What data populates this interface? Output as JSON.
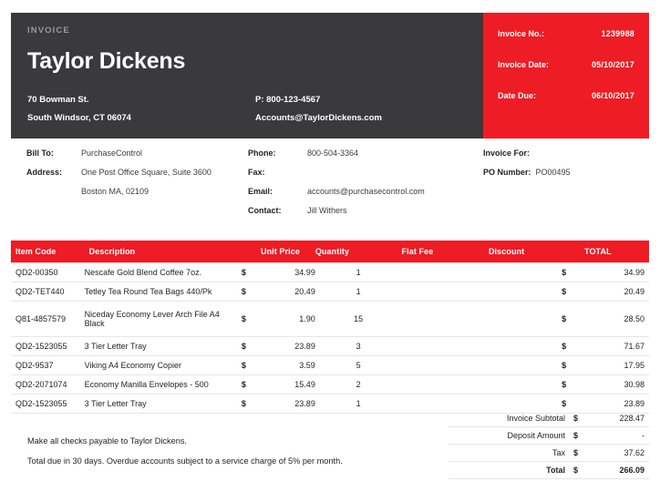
{
  "header": {
    "kicker": "INVOICE",
    "company_name": "Taylor Dickens",
    "address_line1": "70 Bowman St.",
    "address_line2": "South Windsor, CT 06074",
    "phone": "P: 800-123-4567",
    "email": "Accounts@TaylorDickens.com",
    "panel_dark_color": "#3a3a3c",
    "panel_red_color": "#ee1c25"
  },
  "invoice_meta": [
    {
      "label": "Invoice No.:",
      "value": "1239988"
    },
    {
      "label": "Invoice Date:",
      "value": "05/10/2017"
    },
    {
      "label": "Date Due:",
      "value": "06/10/2017"
    }
  ],
  "bill_to": {
    "bill_to_label": "Bill To:",
    "bill_to_value": "PurchaseControl",
    "address_label": "Address:",
    "address_line1": "One Post Office Square, Suite 3600",
    "address_line2": "Boston MA, 02109"
  },
  "contact": {
    "phone_label": "Phone:",
    "phone_value": "800-504-3364",
    "fax_label": "Fax:",
    "fax_value": "",
    "email_label": "Email:",
    "email_value": "accounts@purchasecontrol.com",
    "contact_label": "Contact:",
    "contact_value": "Jill Withers"
  },
  "invoice_for": {
    "title_label": "Invoice For:",
    "title_value": "",
    "po_label": "PO Number:",
    "po_value": "PO00495"
  },
  "table": {
    "columns": {
      "item_code": "Item Code",
      "description": "Description",
      "unit_price": "Unit Price",
      "quantity": "Quantity",
      "flat_fee": "Flat Fee",
      "discount": "Discount",
      "total": "TOTAL"
    },
    "rows": [
      {
        "code": "QD2-00350",
        "desc": "Nescafe Gold Blend Coffee 7oz.",
        "cur1": "$",
        "price": "34.99",
        "qty": "1",
        "flat": "",
        "disc": "",
        "cur2": "$",
        "total": "34.99"
      },
      {
        "code": "QD2-TET440",
        "desc": "Tetley Tea Round Tea Bags 440/Pk",
        "cur1": "$",
        "price": "20.49",
        "qty": "1",
        "flat": "",
        "disc": "",
        "cur2": "$",
        "total": "20.49"
      },
      {
        "code": "Q81-4857579",
        "desc": "Niceday Economy Lever Arch File A4 Black",
        "cur1": "$",
        "price": "1.90",
        "qty": "15",
        "flat": "",
        "disc": "",
        "cur2": "$",
        "total": "28.50"
      },
      {
        "code": "QD2-1523055",
        "desc": "3 Tier Letter Tray",
        "cur1": "$",
        "price": "23.89",
        "qty": "3",
        "flat": "",
        "disc": "",
        "cur2": "$",
        "total": "71.67"
      },
      {
        "code": "QD2-9537",
        "desc": "Viking A4 Economy Copier",
        "cur1": "$",
        "price": "3.59",
        "qty": "5",
        "flat": "",
        "disc": "",
        "cur2": "$",
        "total": "17.95"
      },
      {
        "code": "QD2-2071074",
        "desc": "Economy Manilla Envelopes - 500",
        "cur1": "$",
        "price": "15.49",
        "qty": "2",
        "flat": "",
        "disc": "",
        "cur2": "$",
        "total": "30.98"
      },
      {
        "code": "QD2-1523055",
        "desc": "3 Tier Letter Tray",
        "cur1": "$",
        "price": "23.89",
        "qty": "1",
        "flat": "",
        "disc": "",
        "cur2": "$",
        "total": "23.89"
      }
    ]
  },
  "notes": {
    "line1": "Make all checks payable to Taylor Dickens.",
    "line2": "Total due in 30 days. Overdue accounts subject to a service charge of 5% per month."
  },
  "totals": [
    {
      "label": "Invoice Subtotal",
      "cur": "$",
      "value": "228.47"
    },
    {
      "label": "Deposit Amount",
      "cur": "$",
      "value": "-"
    },
    {
      "label": "Tax",
      "cur": "$",
      "value": "37.62"
    },
    {
      "label": "Total",
      "cur": "$",
      "value": "266.09"
    }
  ]
}
